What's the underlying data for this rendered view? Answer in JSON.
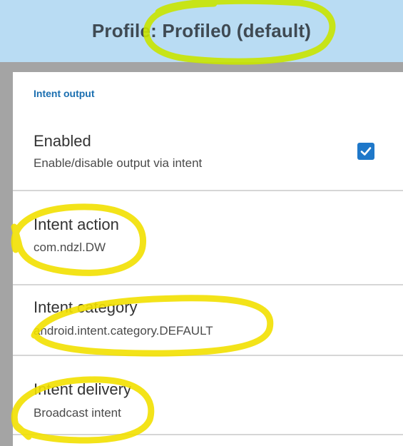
{
  "header": {
    "title": "Profile: Profile0 (default)"
  },
  "section": {
    "label": "Intent output"
  },
  "settings": [
    {
      "title": "Enabled",
      "subtitle": "Enable/disable output via intent",
      "checked": true
    },
    {
      "title": "Intent action",
      "subtitle": "com.ndzl.DW"
    },
    {
      "title": "Intent category",
      "subtitle": "android.intent.category.DEFAULT"
    },
    {
      "title": "Intent delivery",
      "subtitle": "Broadcast intent"
    }
  ],
  "colors": {
    "header_bg": "#b9dcf3",
    "accent": "#1f78c9",
    "highlight_green": "#c9e400",
    "highlight_yellow": "#f2e000"
  }
}
